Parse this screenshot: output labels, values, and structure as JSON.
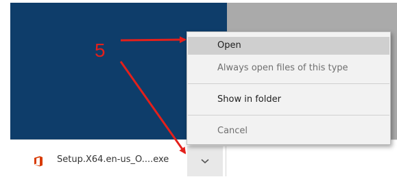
{
  "download": {
    "filename": "Setup.X64.en-us_O....exe",
    "file_icon": "office-logo-icon",
    "dropdown_icon": "chevron-down-icon"
  },
  "context_menu": {
    "items": [
      {
        "label": "Open",
        "state": "highlighted"
      },
      {
        "label": "Always open files of this type",
        "state": "disabled"
      },
      {
        "label": "Show in folder",
        "state": "normal"
      },
      {
        "label": "Cancel",
        "state": "disabled"
      }
    ]
  },
  "annotation": {
    "step_number": "5",
    "color": "#e3201b"
  },
  "colors": {
    "page_left_bg": "#0e3d6a",
    "page_right_bg": "#aaaaaa",
    "office_orange": "#d83b01"
  }
}
